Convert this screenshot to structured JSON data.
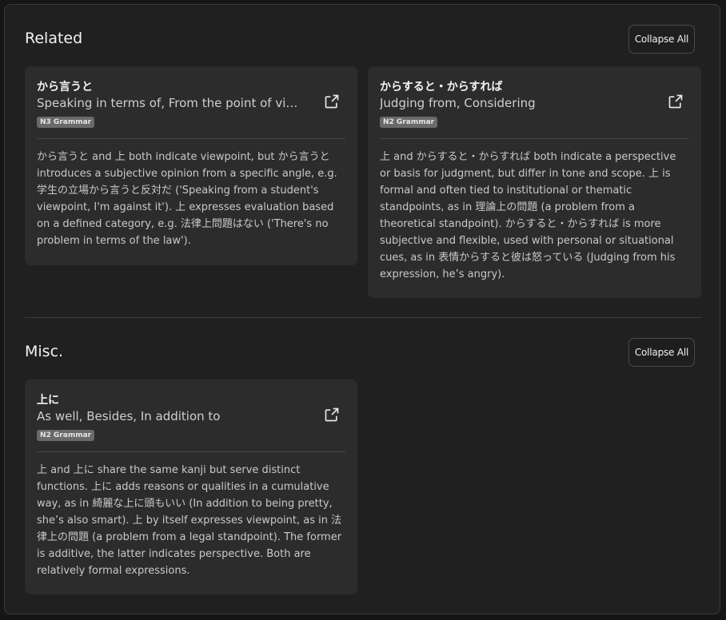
{
  "sections": [
    {
      "title": "Related",
      "collapse_label": "Collapse All",
      "cards": [
        {
          "term": "から言うと",
          "meaning": "Speaking in terms of, From the point of view of",
          "badge": "N3 Grammar",
          "description": "から言うと and 上 both indicate viewpoint, but から言うと introduces a subjective opinion from a specific angle, e.g. 学生の立場から言うと反対だ ('Speaking from a student's viewpoint, I'm against it'). 上 expresses evaluation based on a defined category, e.g. 法律上問題はない ('There's no problem in terms of the law').",
          "icon": "external-link-icon"
        },
        {
          "term": "からすると・からすれば",
          "meaning": "Judging from, Considering",
          "badge": "N2 Grammar",
          "description": "上 and からすると・からすれば both indicate a perspective or basis for judgment, but differ in tone and scope. 上 is formal and often tied to institutional or thematic standpoints, as in 理論上の問題 (a problem from a theoretical standpoint). からすると・からすれば is more subjective and flexible, used with personal or situational cues, as in 表情からすると彼は怒っている (Judging from his expression, he’s angry).",
          "icon": "external-link-icon"
        }
      ]
    },
    {
      "title": "Misc.",
      "collapse_label": "Collapse All",
      "cards": [
        {
          "term": "上に",
          "meaning": "As well, Besides, In addition to",
          "badge": "N2 Grammar",
          "description": "上 and 上に share the same kanji but serve distinct functions. 上に adds reasons or qualities in a cumulative way, as in 綺麗な上に頭もいい (In addition to being pretty, she’s also smart). 上 by itself expresses viewpoint, as in 法律上の問題 (a problem from a legal standpoint). The former is additive, the latter indicates perspective. Both are relatively formal expressions.",
          "icon": "external-link-icon"
        }
      ]
    }
  ],
  "colors": {
    "background": "#202020",
    "card": "#2c2c2c",
    "badge": "#6a6a6a"
  }
}
